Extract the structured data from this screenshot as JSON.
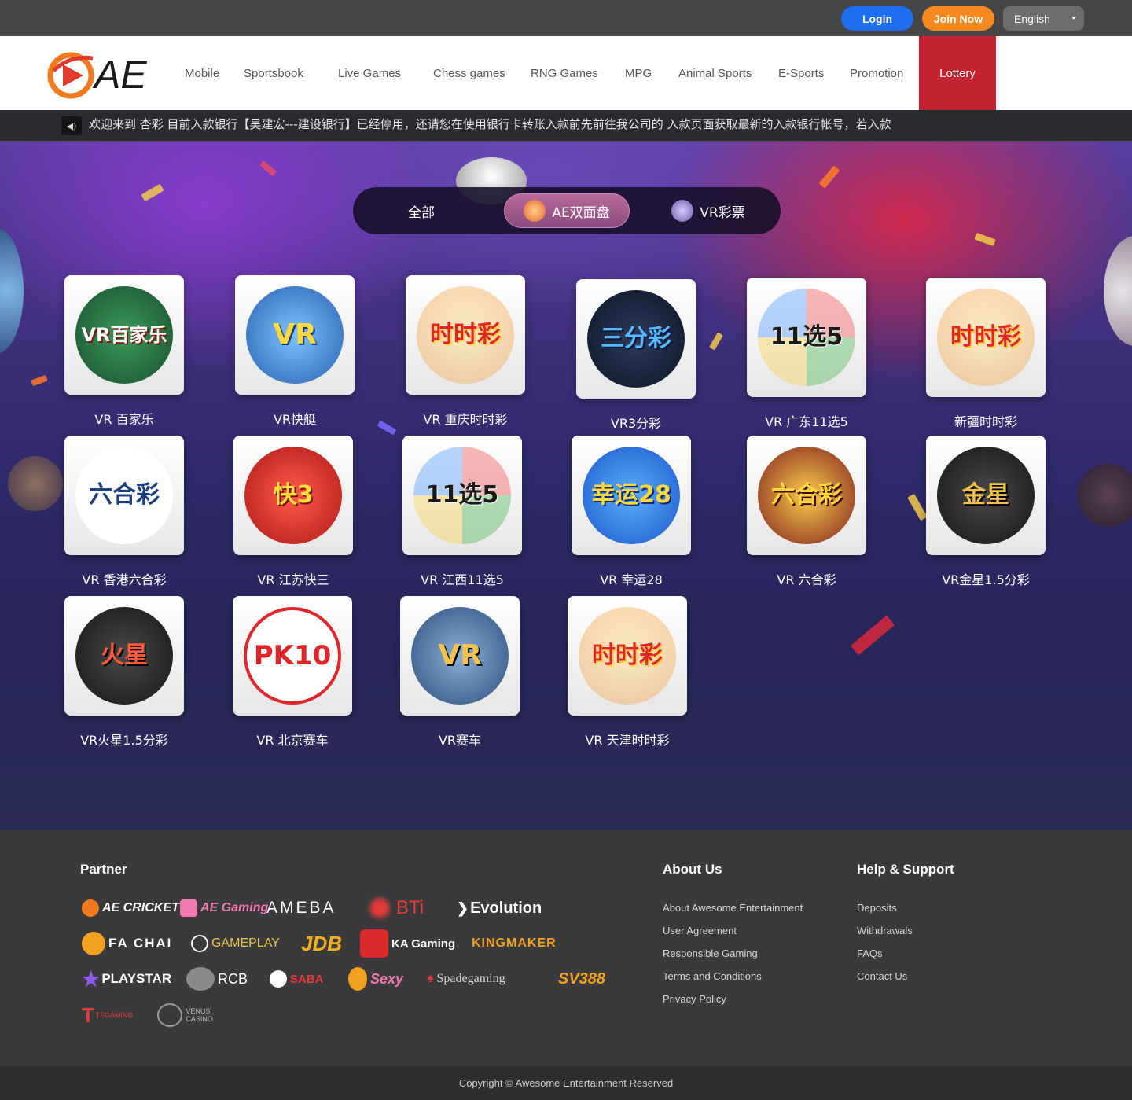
{
  "header": {
    "login_label": "Login",
    "join_label": "Join Now",
    "language": "English"
  },
  "brand": {
    "logo_text": "AE"
  },
  "nav": {
    "items": [
      "Mobile",
      "Sportsbook",
      "Live Games",
      "Chess games",
      "RNG Games",
      "MPG",
      "Animal Sports",
      "E-Sports",
      "Promotion"
    ],
    "active": "Lottery"
  },
  "marquee": {
    "text": "欢迎来到 杏彩   目前入款银行【吴建宏---建设银行】已经停用，还请您在使用银行卡转账入款前先前往我公司的 入款页面获取最新的入款银行帐号，若入款"
  },
  "tabs": [
    {
      "label": "全部",
      "icon": ""
    },
    {
      "label": "AE双面盘",
      "icon": "ae-logo-icon"
    },
    {
      "label": "VR彩票",
      "icon": "vr-logo-icon"
    }
  ],
  "games": [
    {
      "label": "VR 百家乐",
      "art": "VR百家乐",
      "color": "#1f6b3a"
    },
    {
      "label": "VR快艇",
      "art": "VR",
      "color": "#2a78c8"
    },
    {
      "label": "VR 重庆时时彩",
      "art": "时时彩",
      "color": "#d6262b"
    },
    {
      "label": "VR3分彩",
      "art": "三分彩",
      "color": "#1b2a4a"
    },
    {
      "label": "VR 广东11选5",
      "art": "11选5",
      "color": "#d92b2b"
    },
    {
      "label": "新疆时时彩",
      "art": "时时彩",
      "color": "#d6262b"
    },
    {
      "label": "VR 香港六合彩",
      "art": "六合彩",
      "color": "#1d3f82"
    },
    {
      "label": "VR 江苏快三",
      "art": "快3",
      "color": "#e22a2a"
    },
    {
      "label": "VR 江西11选5",
      "art": "11选5",
      "color": "#e33a2c"
    },
    {
      "label": "VR 幸运28",
      "art": "幸运28",
      "color": "#2b6ad1"
    },
    {
      "label": "VR 六合彩",
      "art": "六合彩",
      "color": "#7b1f1f"
    },
    {
      "label": "VR金星1.5分彩",
      "art": "金星",
      "color": "#2a2a2a"
    },
    {
      "label": "VR火星1.5分彩",
      "art": "火星",
      "color": "#2a2a2a"
    },
    {
      "label": "VR 北京赛车",
      "art": "PK10",
      "color": "#e0262b"
    },
    {
      "label": "VR赛车",
      "art": "VR",
      "color": "#2b4d7a"
    },
    {
      "label": "VR 天津时时彩",
      "art": "时时彩",
      "color": "#d6262b"
    }
  ],
  "footer": {
    "partner_title": "Partner",
    "partners": [
      {
        "name": "AE CRICKET",
        "color": "#ffffff",
        "icon": "ae-icon"
      },
      {
        "name": "AE Gaming",
        "color": "#f07ab0",
        "icon": "gaming-icon"
      },
      {
        "name": "AMEBA",
        "color": "#ffffff",
        "icon": ""
      },
      {
        "name": "BTi",
        "color": "#e23a3a",
        "icon": "bti-icon"
      },
      {
        "name": "Evolution",
        "color": "#ffffff",
        "icon": "evolution-icon"
      },
      {
        "name": "FA CHAI",
        "color": "#ffffff",
        "icon": "fachai-icon"
      },
      {
        "name": "GAMEPLAY",
        "color": "#e8c64a",
        "icon": "gameplay-icon"
      },
      {
        "name": "JDB",
        "color": "#f2b01e",
        "icon": ""
      },
      {
        "name": "KA Gaming",
        "color": "#ffffff",
        "icon": "ka-icon"
      },
      {
        "name": "KINGMAKER",
        "color": "#f2a11e",
        "icon": ""
      },
      {
        "name": "PLAYSTAR",
        "color": "#ffffff",
        "icon": "star-icon"
      },
      {
        "name": "RCB",
        "color": "#ffffff",
        "icon": "horse-icon"
      },
      {
        "name": "SABA",
        "color": "#e23a3a",
        "icon": "saba-icon"
      },
      {
        "name": "Sexy",
        "color": "#f07ab0",
        "icon": "sexy-icon"
      },
      {
        "name": "Spadegaming",
        "color": "#d6d6d6",
        "icon": "spade-icon"
      },
      {
        "name": "SV388",
        "color": "#f2a11e",
        "icon": ""
      },
      {
        "name": "TFGAMING",
        "color": "#e23a3a",
        "icon": "tf-icon"
      },
      {
        "name": "VENUS CASINO",
        "color": "#bfbfbf",
        "icon": "venus-icon"
      }
    ],
    "about_title": "About Us",
    "about_links": [
      "About Awesome Entertainment",
      "User Agreement",
      "Responsible Gaming",
      "Terms and Conditions",
      "Privacy Policy"
    ],
    "help_title": "Help & Support",
    "help_links": [
      "Deposits",
      "Withdrawals",
      "FAQs",
      "Contact Us"
    ],
    "copyright": "Copyright © Awesome Entertainment Reserved"
  },
  "colors": {
    "login": "#1d6ef0",
    "join": "#f5891f",
    "lottery_active": "#c4232d"
  }
}
